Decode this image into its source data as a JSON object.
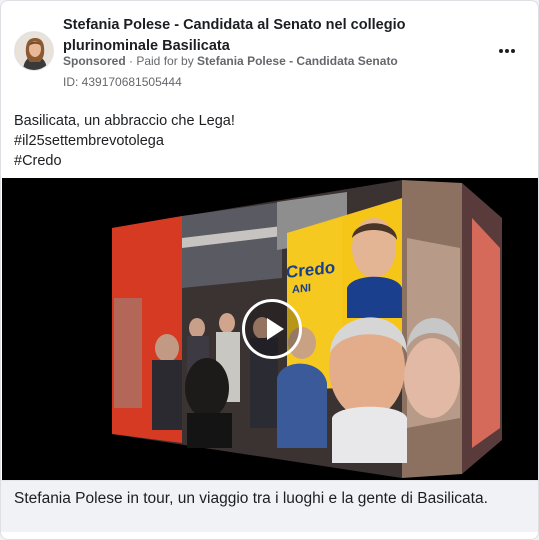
{
  "ad": {
    "advertiser_name": "Stefania Polese - Candidata al Senato nel collegio plurinominale Basilicata",
    "sponsored_label": "Sponsored",
    "paid_prefix": " · Paid for by ",
    "paid_by": "Stefania Polese - Candidata Senato",
    "id_text": "ID: 439170681505444",
    "menu_icon": "more-options-icon"
  },
  "post": {
    "lines": [
      "Basilicata, un abbraccio che Lega!",
      "#il25settembrevotolega",
      "#Credo"
    ]
  },
  "media": {
    "play_icon": "play-icon",
    "sign_text_1": "Credo",
    "sign_text_2": "ANI",
    "colors": {
      "sign_yellow": "#f5c518",
      "sign_blue": "#1a3f8c",
      "wall_red": "#d63a22"
    }
  },
  "caption": {
    "text": "Stefania Polese in tour, un viaggio tra i luoghi e la gente di Basilicata."
  }
}
